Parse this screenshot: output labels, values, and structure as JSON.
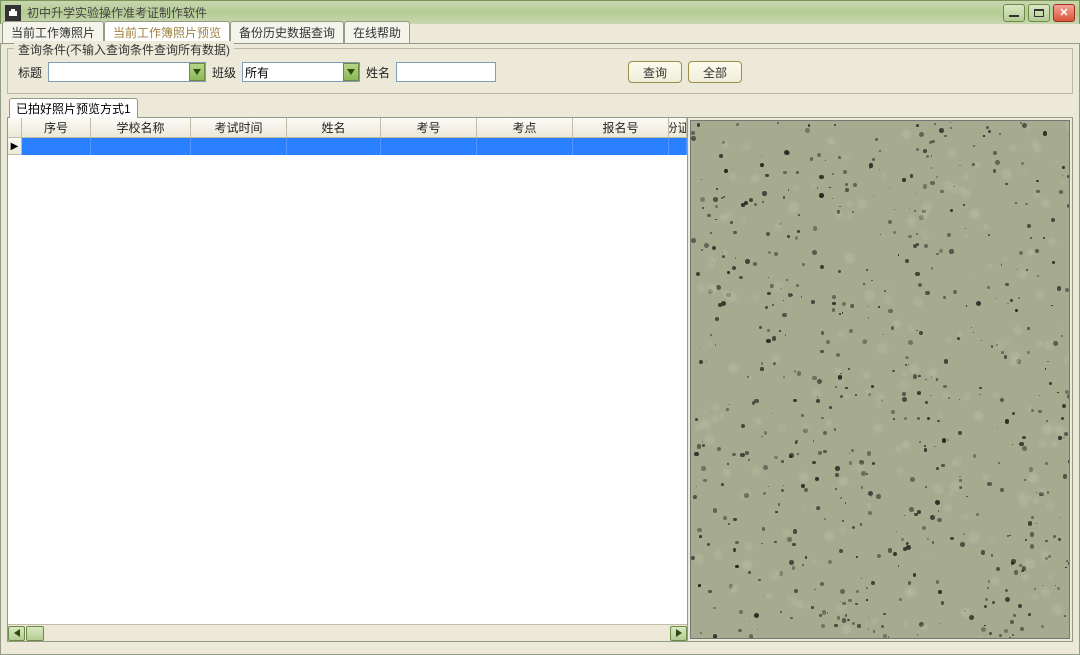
{
  "window": {
    "title": "初中升学实验操作准考证制作软件"
  },
  "tabs": {
    "items": [
      {
        "label": "当前工作簿照片"
      },
      {
        "label": "当前工作簿照片预览"
      },
      {
        "label": "备份历史数据查询"
      },
      {
        "label": "在线帮助"
      }
    ],
    "active_index": 1
  },
  "query": {
    "group_title": "查询条件(不输入查询条件查询所有数据)",
    "labels": {
      "title": "标题",
      "class": "班级",
      "name": "姓名"
    },
    "title_value": "",
    "class_value": "所有",
    "name_value": "",
    "buttons": {
      "search": "查询",
      "all": "全部"
    }
  },
  "sub_tabs": {
    "items": [
      {
        "label": "已拍好照片预览方式1"
      }
    ],
    "active_index": 0
  },
  "grid": {
    "columns": [
      {
        "label": "序号",
        "width": 69
      },
      {
        "label": "学校名称",
        "width": 100
      },
      {
        "label": "考试时间",
        "width": 96
      },
      {
        "label": "姓名",
        "width": 94
      },
      {
        "label": "考号",
        "width": 96
      },
      {
        "label": "考点",
        "width": 96
      },
      {
        "label": "报名号",
        "width": 96
      },
      {
        "label": "份证",
        "width": 24
      }
    ],
    "row_indicator_width": 14,
    "selected_row_empty": true
  }
}
